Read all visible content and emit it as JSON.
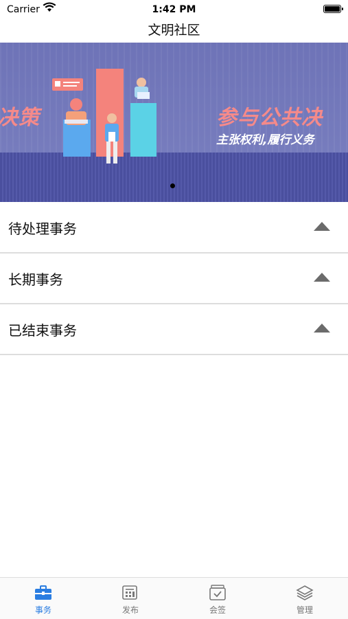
{
  "status_bar": {
    "carrier": "Carrier",
    "time": "1:42 PM"
  },
  "nav": {
    "title": "文明社区"
  },
  "banner": {
    "left_text": "决策",
    "headline": "参与公共决",
    "subtitle": "主张权利,履行义务",
    "page_count": 1,
    "active_page": 1
  },
  "sections": [
    {
      "label": "待处理事务",
      "icon": "collapse-arrow-icon"
    },
    {
      "label": "长期事务",
      "icon": "collapse-arrow-icon"
    },
    {
      "label": "已结束事务",
      "icon": "collapse-arrow-icon"
    }
  ],
  "tabs": [
    {
      "label": "事务",
      "icon": "briefcase-icon",
      "active": true
    },
    {
      "label": "发布",
      "icon": "publish-icon",
      "active": false
    },
    {
      "label": "会签",
      "icon": "countersign-icon",
      "active": false
    },
    {
      "label": "管理",
      "icon": "layers-icon",
      "active": false
    }
  ],
  "colors": {
    "accent": "#2a7de1",
    "banner_text": "#f58a8a",
    "tab_inactive": "#777777"
  }
}
